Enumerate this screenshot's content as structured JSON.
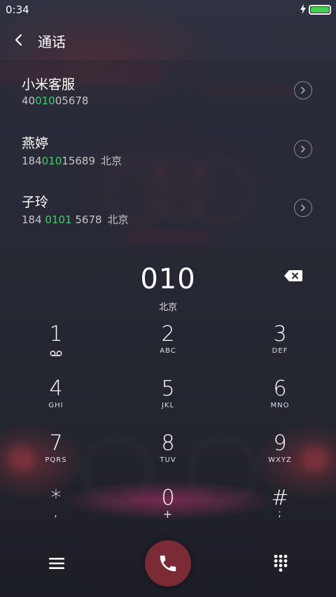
{
  "status_bar": {
    "time": "0:34",
    "battery_icon": "battery-icon",
    "charging_icon": "lightning-icon",
    "battery_color": "#3fd24a"
  },
  "header": {
    "back_icon": "chevron-left-icon",
    "title": "通话"
  },
  "suggestions": [
    {
      "name": "小米客服",
      "number_pre": "40",
      "number_match": "010",
      "number_post": "05678",
      "location": "",
      "detail_icon": "chevron-right-circle-icon"
    },
    {
      "name": "燕婷",
      "number_pre": "184",
      "number_match": "010",
      "number_post": "15689",
      "location": "北京",
      "detail_icon": "chevron-right-circle-icon"
    },
    {
      "name": "子玲",
      "number_pre": "184 ",
      "number_match": "0101",
      "number_post": " 5678",
      "location": "北京",
      "detail_icon": "chevron-right-circle-icon"
    }
  ],
  "dial": {
    "number": "010",
    "location": "北京",
    "delete_icon": "backspace-icon"
  },
  "keypad": {
    "keys": [
      {
        "digit": "1",
        "letters": "",
        "sub_icon": "voicemail-icon"
      },
      {
        "digit": "2",
        "letters": "ABC"
      },
      {
        "digit": "3",
        "letters": "DEF"
      },
      {
        "digit": "4",
        "letters": "GHI"
      },
      {
        "digit": "5",
        "letters": "JKL"
      },
      {
        "digit": "6",
        "letters": "MNO"
      },
      {
        "digit": "7",
        "letters": "PQRS"
      },
      {
        "digit": "8",
        "letters": "TUV"
      },
      {
        "digit": "9",
        "letters": "WXYZ"
      },
      {
        "digit": "*",
        "letters": ","
      },
      {
        "digit": "0",
        "letters": "+"
      },
      {
        "digit": "#",
        "letters": ";"
      }
    ]
  },
  "bottom_bar": {
    "menu_icon": "menu-icon",
    "call_icon": "phone-icon",
    "keypad_icon": "dialpad-icon",
    "call_color": "#7a2b35"
  },
  "colors": {
    "match_highlight": "#3ccf6e"
  }
}
